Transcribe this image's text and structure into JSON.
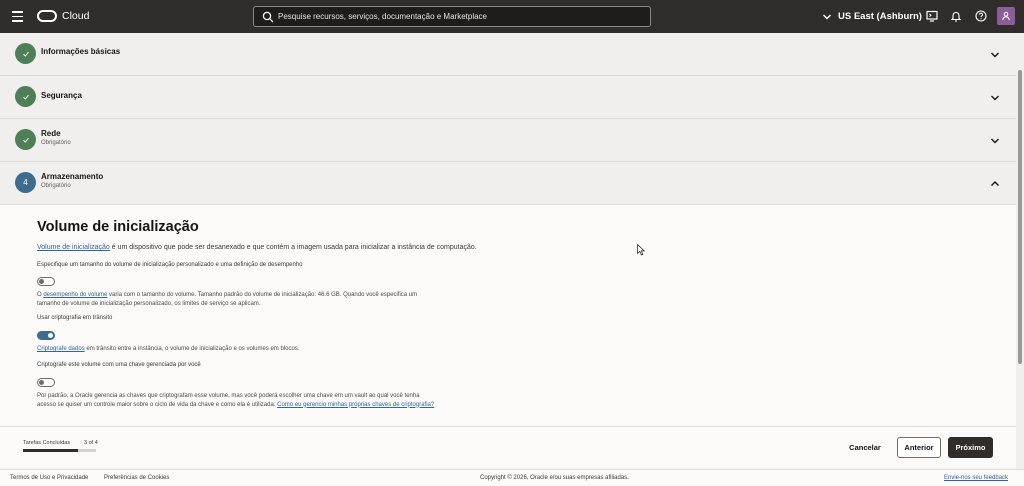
{
  "header": {
    "app_name": "Cloud",
    "search_placeholder": "Pesquise recursos, serviços, documentação e Marketplace",
    "region": "US East (Ashburn)"
  },
  "sections": [
    {
      "title": "Informações básicas",
      "subtitle": "",
      "status": "done",
      "icon": "check-icon"
    },
    {
      "title": "Segurança",
      "subtitle": "",
      "status": "done",
      "icon": "check-icon"
    },
    {
      "title": "Rede",
      "subtitle": "Obrigatório",
      "status": "done",
      "icon": "check-icon"
    },
    {
      "title": "Armazenamento",
      "subtitle": "Obrigatório",
      "status": "active",
      "step_number": "4"
    }
  ],
  "boot_volume": {
    "title": "Volume de inicialização",
    "intro_link": "Volume de inicialização",
    "intro_rest": " é um dispositivo que pode ser desanexado e que contém a imagem usada para inicializar a instância de computação.",
    "custom_size_label": "Especifique um tamanho do volume de inicialização personalizado e uma definição de desempenho",
    "custom_size_on": false,
    "perf_prefix": "O ",
    "perf_link": "desempenho do volume",
    "perf_rest_1": " varia com o tamanho do volume. Tamanho padrão do volume de inicialização: 46.6 GB. Quando você especifica um",
    "perf_rest_2": "tamanho de volume de inicialização personalizado, os limites de serviço se aplicam.",
    "transit_label": "Usar criptografia em trânsito",
    "transit_on": true,
    "transit_link": "Criptografe dados",
    "transit_rest": " em trânsito entre a instância, o volume de inicialização e os volumes em blocos.",
    "cmk_label": "Criptografe este volume com uma chave gerenciada por você",
    "cmk_on": false,
    "cmk_text_1": "Por padrão, a Oracle gerencia as chaves que criptografam esse volume, mas você poderá escolher uma chave em um vault ao qual você tenha",
    "cmk_text_2": "acesso se quiser um controle maior sobre o ciclo de vida da chave e como ela é utilizada. ",
    "cmk_link": "Como eu gerencio minhas próprias chaves de criptografia?"
  },
  "action_bar": {
    "tasks_label": "Tarefas Concluídas",
    "tasks_count": "3 of 4",
    "progress": 0.75,
    "cancel": "Cancelar",
    "previous": "Anterior",
    "next": "Próximo"
  },
  "footer": {
    "terms": "Termos de Uso e Privacidade",
    "cookies": "Preferências de Cookies",
    "copyright": "Copyright © 2026, Oracle e/ou suas empresas afiliadas.",
    "feedback": "Envie-nos seu feedback"
  },
  "colors": {
    "topbar": "#312d2a",
    "done": "#4e7f57",
    "active": "#3e6c8f",
    "link": "#30659f",
    "avatar": "#8b5e9b"
  }
}
